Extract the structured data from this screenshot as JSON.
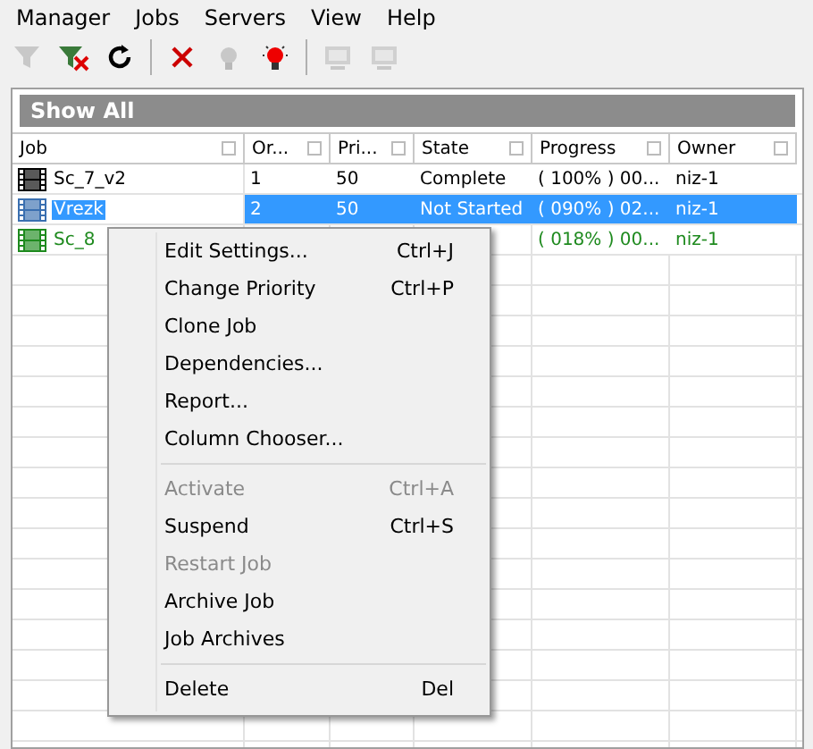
{
  "menu_bar": [
    "Manager",
    "Jobs",
    "Servers",
    "View",
    "Help"
  ],
  "toolbar": [
    {
      "kind": "filter",
      "disabled": true
    },
    {
      "kind": "filter-clear",
      "disabled": false
    },
    {
      "kind": "refresh",
      "disabled": false
    },
    {
      "kind": "separator"
    },
    {
      "kind": "delete",
      "disabled": false
    },
    {
      "kind": "bulb",
      "disabled": true
    },
    {
      "kind": "bulb-red",
      "disabled": false
    },
    {
      "kind": "separator"
    },
    {
      "kind": "monitor",
      "disabled": true
    },
    {
      "kind": "monitor",
      "disabled": true
    }
  ],
  "filter_bar": {
    "label": "Show All"
  },
  "table": {
    "columns": [
      "Job",
      "Or...",
      "Pri...",
      "State",
      "Progress",
      "Owner"
    ],
    "rows": [
      {
        "selected": false,
        "color": "#000000",
        "cells": [
          "Sc_7_v2",
          "1",
          "50",
          "Complete",
          "( 100% ) 00...",
          "niz-1"
        ]
      },
      {
        "selected": true,
        "color": "#3a6fb0",
        "cells": [
          "Vrezk",
          "2",
          "50",
          "Not Started",
          "( 090% ) 02...",
          "niz-1"
        ]
      },
      {
        "selected": false,
        "color": "#1e8a1e",
        "cells": [
          "Sc_8",
          "",
          "",
          "",
          "( 018% ) 00...",
          "niz-1"
        ]
      }
    ]
  },
  "context_menu": [
    {
      "kind": "item",
      "label": "Edit Settings...",
      "shortcut": "Ctrl+J",
      "disabled": false
    },
    {
      "kind": "item",
      "label": "Change Priority",
      "shortcut": "Ctrl+P",
      "disabled": false
    },
    {
      "kind": "item",
      "label": "Clone Job",
      "disabled": false
    },
    {
      "kind": "item",
      "label": "Dependencies...",
      "disabled": false
    },
    {
      "kind": "item",
      "label": "Report...",
      "disabled": false
    },
    {
      "kind": "item",
      "label": "Column Chooser...",
      "disabled": false
    },
    {
      "kind": "separator"
    },
    {
      "kind": "item",
      "label": "Activate",
      "shortcut": "Ctrl+A",
      "disabled": true
    },
    {
      "kind": "item",
      "label": "Suspend",
      "shortcut": "Ctrl+S",
      "disabled": false
    },
    {
      "kind": "item",
      "label": "Restart Job",
      "disabled": true
    },
    {
      "kind": "item",
      "label": "Archive Job",
      "disabled": false
    },
    {
      "kind": "item",
      "label": "Job Archives",
      "disabled": false
    },
    {
      "kind": "separator"
    },
    {
      "kind": "item",
      "label": "Delete",
      "shortcut": "Del",
      "disabled": false
    }
  ]
}
